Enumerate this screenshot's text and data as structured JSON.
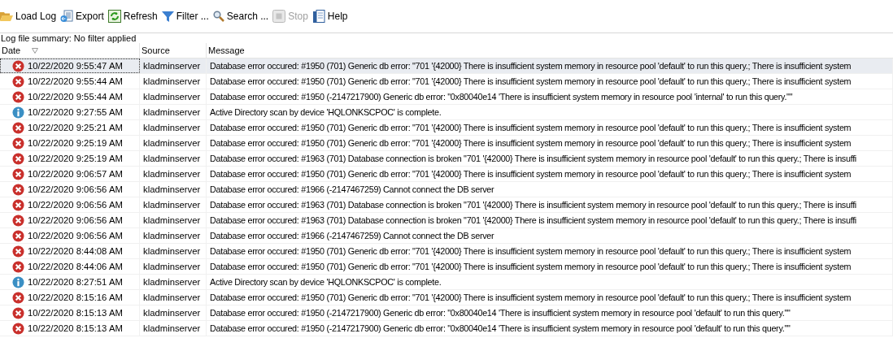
{
  "toolbar": [
    {
      "label": "Load Log",
      "disabled": false
    },
    {
      "label": "Export",
      "disabled": false
    },
    {
      "label": "Refresh",
      "disabled": false
    },
    {
      "label": "Filter ...",
      "disabled": false
    },
    {
      "label": "Search ...",
      "disabled": false
    },
    {
      "label": "Stop",
      "disabled": true
    },
    {
      "label": "Help",
      "disabled": false
    }
  ],
  "summary": "Log file summary: No filter applied",
  "table": {
    "columns": [
      "Date",
      "Source",
      "Message"
    ],
    "rows": [
      {
        "kind": "error",
        "selected": true,
        "date": "10/22/2020 9:55:47 AM",
        "source": "kladminserver",
        "message": "Database error occured: #1950 (701) Generic db error: \"701 '{42000} There is insufficient system memory in resource pool 'default' to run this query.; There is insufficient system"
      },
      {
        "kind": "error",
        "selected": false,
        "date": "10/22/2020 9:55:44 AM",
        "source": "kladminserver",
        "message": "Database error occured: #1950 (701) Generic db error: \"701 '{42000} There is insufficient system memory in resource pool 'default' to run this query.; There is insufficient system"
      },
      {
        "kind": "error",
        "selected": false,
        "date": "10/22/2020 9:55:44 AM",
        "source": "kladminserver",
        "message": "Database error occured: #1950 (-2147217900) Generic db error: \"0x80040e14 'There is insufficient system memory in resource pool 'internal' to run this query.\"\""
      },
      {
        "kind": "info",
        "selected": false,
        "date": "10/22/2020 9:27:55 AM",
        "source": "kladminserver",
        "message": "Active Directory scan by device 'HQLONKSCPOC' is complete."
      },
      {
        "kind": "error",
        "selected": false,
        "date": "10/22/2020 9:25:21 AM",
        "source": "kladminserver",
        "message": "Database error occured: #1950 (701) Generic db error: \"701 '{42000} There is insufficient system memory in resource pool 'default' to run this query.; There is insufficient system"
      },
      {
        "kind": "error",
        "selected": false,
        "date": "10/22/2020 9:25:19 AM",
        "source": "kladminserver",
        "message": "Database error occured: #1950 (701) Generic db error: \"701 '{42000} There is insufficient system memory in resource pool 'default' to run this query.; There is insufficient system"
      },
      {
        "kind": "error",
        "selected": false,
        "date": "10/22/2020 9:25:19 AM",
        "source": "kladminserver",
        "message": "Database error occured: #1963 (701) Database connection is broken \"701 '{42000} There is insufficient system memory in resource pool 'default' to run this query.; There is insuffi"
      },
      {
        "kind": "error",
        "selected": false,
        "date": "10/22/2020 9:06:57 AM",
        "source": "kladminserver",
        "message": "Database error occured: #1950 (701) Generic db error: \"701 '{42000} There is insufficient system memory in resource pool 'default' to run this query.; There is insufficient system"
      },
      {
        "kind": "error",
        "selected": false,
        "date": "10/22/2020 9:06:56 AM",
        "source": "kladminserver",
        "message": "Database error occured: #1966 (-2147467259) Cannot connect the DB server"
      },
      {
        "kind": "error",
        "selected": false,
        "date": "10/22/2020 9:06:56 AM",
        "source": "kladminserver",
        "message": "Database error occured: #1963 (701) Database connection is broken \"701 '{42000} There is insufficient system memory in resource pool 'default' to run this query.; There is insuffi"
      },
      {
        "kind": "error",
        "selected": false,
        "date": "10/22/2020 9:06:56 AM",
        "source": "kladminserver",
        "message": "Database error occured: #1963 (701) Database connection is broken \"701 '{42000} There is insufficient system memory in resource pool 'default' to run this query.; There is insuffi"
      },
      {
        "kind": "error",
        "selected": false,
        "date": "10/22/2020 9:06:56 AM",
        "source": "kladminserver",
        "message": "Database error occured: #1966 (-2147467259) Cannot connect the DB server"
      },
      {
        "kind": "error",
        "selected": false,
        "date": "10/22/2020 8:44:08 AM",
        "source": "kladminserver",
        "message": "Database error occured: #1950 (701) Generic db error: \"701 '{42000} There is insufficient system memory in resource pool 'default' to run this query.; There is insufficient system"
      },
      {
        "kind": "error",
        "selected": false,
        "date": "10/22/2020 8:44:06 AM",
        "source": "kladminserver",
        "message": "Database error occured: #1950 (701) Generic db error: \"701 '{42000} There is insufficient system memory in resource pool 'default' to run this query.; There is insufficient system"
      },
      {
        "kind": "info",
        "selected": false,
        "date": "10/22/2020 8:27:51 AM",
        "source": "kladminserver",
        "message": "Active Directory scan by device 'HQLONKSCPOC' is complete."
      },
      {
        "kind": "error",
        "selected": false,
        "date": "10/22/2020 8:15:16 AM",
        "source": "kladminserver",
        "message": "Database error occured: #1950 (701) Generic db error: \"701 '{42000} There is insufficient system memory in resource pool 'default' to run this query.; There is insufficient system"
      },
      {
        "kind": "error",
        "selected": false,
        "date": "10/22/2020 8:15:13 AM",
        "source": "kladminserver",
        "message": "Database error occured: #1950 (-2147217900) Generic db error: \"0x80040e14 'There is insufficient system memory in resource pool 'default' to run this query.\"\""
      },
      {
        "kind": "error",
        "selected": false,
        "date": "10/22/2020 8:15:13 AM",
        "source": "kladminserver",
        "message": "Database error occured: #1950 (-2147217900) Generic db error: \"0x80040e14 'There is insufficient system memory in resource pool 'default' to run this query.\"\""
      }
    ]
  }
}
